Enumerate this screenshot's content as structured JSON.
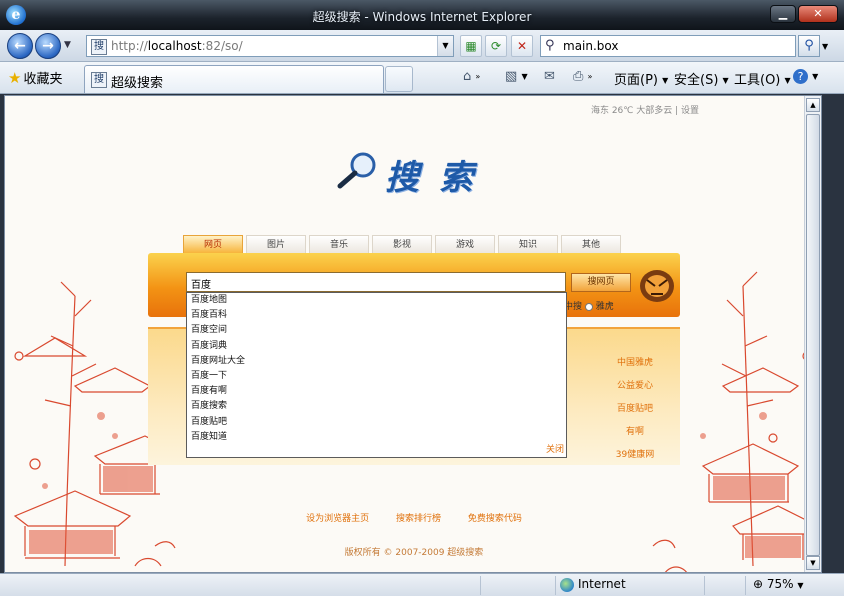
{
  "window": {
    "title": "超级搜索 - Windows Internet Explorer"
  },
  "address_bar": {
    "url_prefix": "http://",
    "url_host": "localhost",
    "url_rest": ":82/so/",
    "search_text": "main.box"
  },
  "command_bar": {
    "favorites_label": "收藏夹",
    "tab_title": "超级搜索",
    "page_menu": "页面(P)",
    "safety_menu": "安全(S)",
    "tools_menu": "工具(O)"
  },
  "page": {
    "weather": "海东 26℃ 大部多云 | 设置",
    "logo_text": "搜索",
    "search_tabs": [
      "网页",
      "图片",
      "音乐",
      "影视",
      "游戏",
      "知识",
      "其他"
    ],
    "query": "百度",
    "search_button": "搜网页",
    "radio_options": [
      "中搜",
      "雅虎"
    ],
    "suggestions": [
      "百度地图",
      "百度百科",
      "百度空间",
      "百度词典",
      "百度网址大全",
      "百度一下",
      "百度有啊",
      "百度搜索",
      "百度贴吧",
      "百度知道"
    ],
    "suggest_close": "关闭",
    "side_links": [
      "中国雅虎",
      "公益爱心",
      "百度贴吧",
      "有啊",
      "39健康网"
    ],
    "footer_links": [
      "设为浏览器主页",
      "搜索排行榜",
      "免费搜索代码"
    ],
    "copyright": "版权所有 © 2007-2009 超级搜索"
  },
  "status_bar": {
    "zone": "Internet",
    "zoom": "75%"
  }
}
